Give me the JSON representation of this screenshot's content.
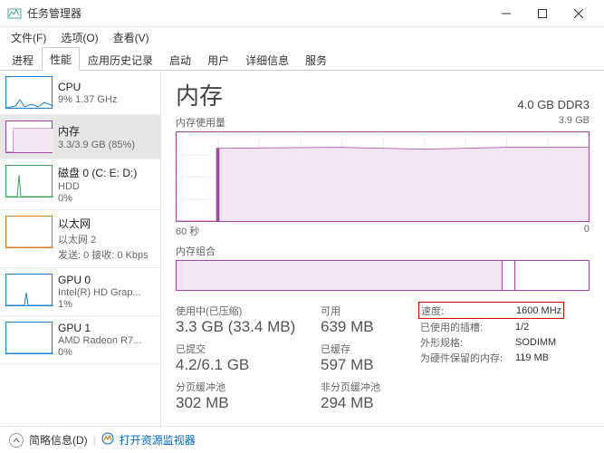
{
  "window": {
    "title": "任务管理器",
    "menus": [
      "文件(F)",
      "选项(O)",
      "查看(V)"
    ],
    "tabs": [
      "进程",
      "性能",
      "应用历史记录",
      "启动",
      "用户",
      "详细信息",
      "服务"
    ],
    "active_tab": 1
  },
  "sidebar": [
    {
      "name": "CPU",
      "sub": "9% 1.37 GHz",
      "color": "blue"
    },
    {
      "name": "内存",
      "sub": "3.3/3.9 GB (85%)",
      "color": "purple",
      "selected": true
    },
    {
      "name": "磁盘 0 (C: E: D:)",
      "sub": "HDD",
      "sub2": "0%",
      "color": "green"
    },
    {
      "name": "以太网",
      "sub": "以太网 2",
      "sub2": "发送: 0 接收: 0 Kbps",
      "color": "orange"
    },
    {
      "name": "GPU 0",
      "sub": "Intel(R) HD Grap...",
      "sub2": "1%",
      "color": "blue"
    },
    {
      "name": "GPU 1",
      "sub": "AMD Radeon R7...",
      "sub2": "0%",
      "color": "blue"
    }
  ],
  "main": {
    "title": "内存",
    "capacity": "4.0 GB DDR3",
    "usage_label": "内存使用量",
    "usage_max": "3.9 GB",
    "time_label_left": "60 秒",
    "time_label_right": "0",
    "compose_label": "内存组合"
  },
  "stats": {
    "in_use": {
      "label": "使用中(已压缩)",
      "value": "3.3 GB (33.4 MB)"
    },
    "available": {
      "label": "可用",
      "value": "639 MB"
    },
    "committed": {
      "label": "已提交",
      "value": "4.2/6.1 GB"
    },
    "cached": {
      "label": "已缓存",
      "value": "597 MB"
    },
    "paged": {
      "label": "分页缓冲池",
      "value": "302 MB"
    },
    "nonpaged": {
      "label": "非分页缓冲池",
      "value": "294 MB"
    }
  },
  "details": {
    "speed_k": "速度:",
    "speed_v": "1600 MHz",
    "slots_k": "已使用的插槽:",
    "slots_v": "1/2",
    "form_k": "外形规格:",
    "form_v": "SODIMM",
    "reserved_k": "为硬件保留的内存:",
    "reserved_v": "119 MB"
  },
  "footer": {
    "fewer": "简略信息(D)",
    "open_rm": "打开资源监视器"
  },
  "chart_data": {
    "type": "line",
    "title": "内存使用量",
    "xlabel": "秒",
    "ylabel": "GB",
    "ylim": [
      0,
      3.9
    ],
    "x_range_seconds": [
      60,
      0
    ],
    "series": [
      {
        "name": "使用中",
        "values": [
          0,
          0,
          0,
          0,
          0,
          3.2,
          3.3,
          3.3,
          3.3,
          3.3,
          3.25,
          3.3,
          3.3,
          3.3,
          3.3,
          3.3,
          3.3,
          3.3,
          3.3,
          3.3,
          3.3,
          3.3,
          3.3,
          3.3,
          3.3,
          3.3,
          3.3,
          3.3,
          3.3,
          3.3
        ]
      }
    ]
  }
}
